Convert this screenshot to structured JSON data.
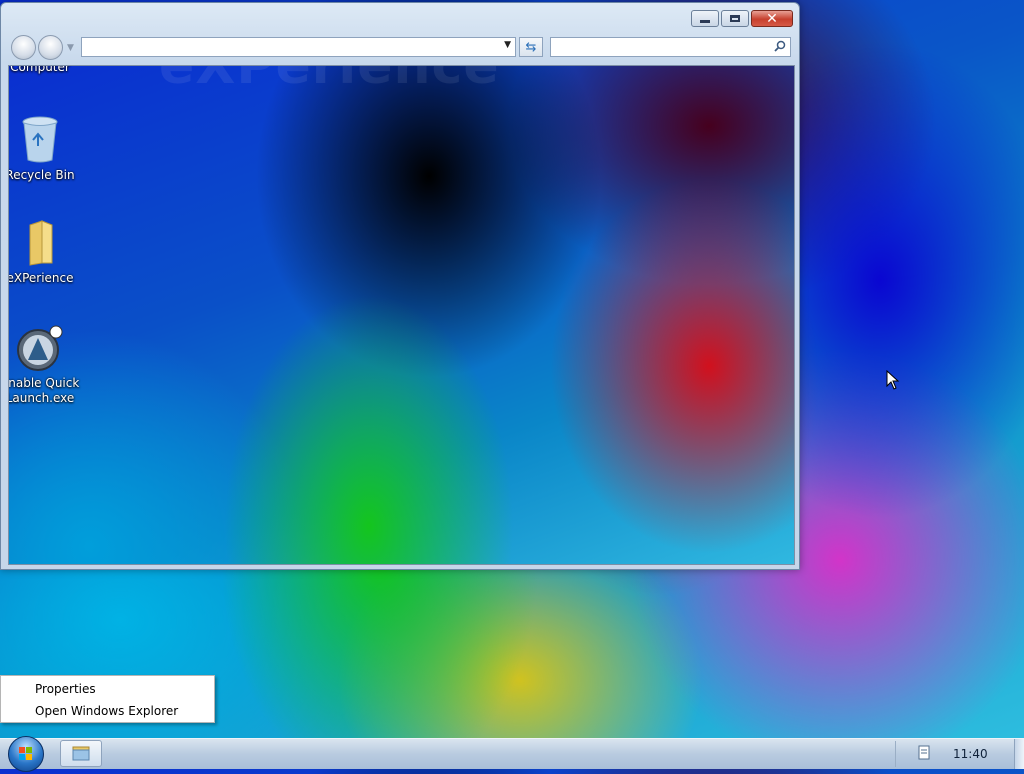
{
  "window": {
    "content_watermark": "eXPerience",
    "address_value": "",
    "search_value": ""
  },
  "desktop_icons": [
    {
      "label": "Computer",
      "icon": "computer-icon"
    },
    {
      "label": "Recycle Bin",
      "icon": "recycle-bin-icon"
    },
    {
      "label": "eXPerience",
      "icon": "folder-icon"
    },
    {
      "label": "Enable Quick Launch.exe",
      "label_line1": "Enable Quick",
      "label_line2": "Launch.exe",
      "icon": "app-icon"
    }
  ],
  "context_menu": {
    "items": [
      {
        "label": "Properties"
      },
      {
        "label": "Open Windows Explorer"
      }
    ]
  },
  "taskbar": {
    "clock": "11:40",
    "start_icon": "windows-orb-icon",
    "pinned": [
      {
        "icon": "explorer-folder-icon"
      }
    ]
  },
  "colors": {
    "window_frame": "#c8d9ec",
    "close_button": "#c7402e",
    "taskbar": "#b9cbe0"
  }
}
